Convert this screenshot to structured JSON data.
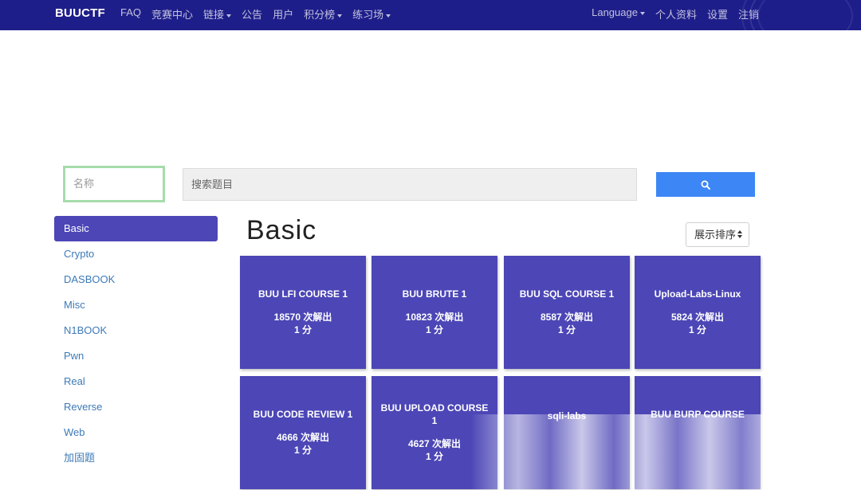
{
  "navbar": {
    "brand": "BUUCTF",
    "left_items": [
      {
        "label": "FAQ",
        "dropdown": false
      },
      {
        "label": "竞赛中心",
        "dropdown": false
      },
      {
        "label": "链接",
        "dropdown": true
      },
      {
        "label": "公告",
        "dropdown": false
      },
      {
        "label": "用户",
        "dropdown": false
      },
      {
        "label": "积分榜",
        "dropdown": true
      },
      {
        "label": "练习场",
        "dropdown": true
      }
    ],
    "right_items": [
      {
        "label": "Language",
        "dropdown": true
      },
      {
        "label": "个人资料",
        "dropdown": false
      },
      {
        "label": "设置",
        "dropdown": false
      },
      {
        "label": "注销",
        "dropdown": false
      }
    ]
  },
  "search": {
    "name_placeholder": "名称",
    "query_placeholder": "搜索题目",
    "button_icon": "search-icon"
  },
  "sidebar": {
    "items": [
      "Basic",
      "Crypto",
      "DASBOOK",
      "Misc",
      "N1BOOK",
      "Pwn",
      "Real",
      "Reverse",
      "Web",
      "加固题"
    ],
    "active": "Basic"
  },
  "main": {
    "title": "Basic",
    "sort_label": "展示排序"
  },
  "challenges": [
    {
      "name": "BUU LFI COURSE 1",
      "solves": "18570 次解出",
      "points": "1 分"
    },
    {
      "name": "BUU BRUTE 1",
      "solves": "10823 次解出",
      "points": "1 分"
    },
    {
      "name": "BUU SQL COURSE 1",
      "solves": "8587 次解出",
      "points": "1 分"
    },
    {
      "name": "Upload-Labs-Linux",
      "solves": "5824 次解出",
      "points": "1 分"
    },
    {
      "name": "BUU CODE REVIEW 1",
      "solves": "4666 次解出",
      "points": "1 分"
    },
    {
      "name": "BUU UPLOAD COURSE 1",
      "solves": "4627 次解出",
      "points": "1 分"
    },
    {
      "name": "sqli-labs",
      "solves": "",
      "points": ""
    },
    {
      "name": "BUU BURP COURSE",
      "solves": "",
      "points": ""
    }
  ],
  "colors": {
    "navbar": "#1e1e8a",
    "accent": "#4c46b6",
    "search_button": "#3d86f5",
    "link": "#3d7ab8"
  }
}
